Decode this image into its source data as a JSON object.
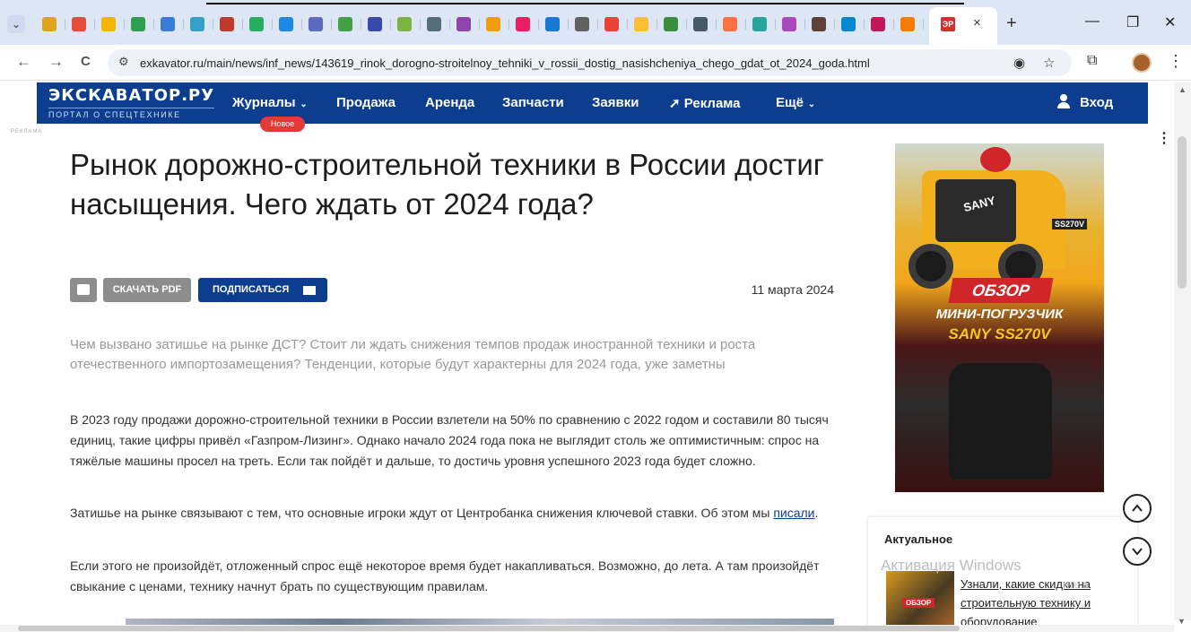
{
  "browser": {
    "tabs_count_icons": 31,
    "active_tab_favicon": "ЭР",
    "url": "exkavator.ru/main/news/inf_news/143619_rinok_dorogno-stroitelnoy_tehniki_v_rossii_dostig_nasishcheniya_chego_gdat_ot_2024_goda.html",
    "icons": {
      "back": "←",
      "forward": "→",
      "reload": "C",
      "close_tab": "×",
      "new_tab": "+",
      "minimize": "—",
      "restore": "❐",
      "close_window": "✕",
      "site_info": "⚙",
      "eye_off": "◉",
      "star": "☆",
      "extensions": "⧉",
      "menu": "⋮"
    }
  },
  "site": {
    "logo": "ЭКСКАВАТОР.РУ",
    "logo_subtitle": "ПОРТАЛ О СПЕЦТЕХНИКЕ",
    "nav": [
      {
        "label": "Журналы",
        "dropdown": true
      },
      {
        "label": "Продажа"
      },
      {
        "label": "Аренда"
      },
      {
        "label": "Запчасти"
      },
      {
        "label": "Заявки"
      },
      {
        "label": "Реклама"
      },
      {
        "label": "Ещё",
        "dropdown": true
      }
    ],
    "nav_badge": "Новое",
    "login": "Вход",
    "ad_label": "РЕКЛАМА"
  },
  "article": {
    "title": "Рынок дорожно-строительной техники в России достиг насыщения. Чего ждать от 2024 года?",
    "btn_pdf": "СКАЧАТЬ PDF",
    "btn_subscribe": "ПОДПИСАТЬСЯ",
    "date": "11 марта 2024",
    "lead": "Чем вызвано затишье на рынке ДСТ? Стоит ли ждать снижения темпов продаж иностранной техники и роста отечественного импортозамещения? Тенденции, которые будут характерны для 2024 года, уже заметны",
    "p1": "В 2023 году продажи дорожно-строительной техники в России взлетели на 50% по сравнению с 2022 годом и составили 80 тысяч единиц, такие цифры привёл «Газпром-Лизинг». Однако начало 2024 года пока не выглядит столь же оптимистичным: спрос на тяжёлые машины просел на треть. Если так пойдёт и дальше, то достичь уровня успешного 2023 года будет сложно.",
    "p2_text": "Затишье на рынке связывают с тем, что основные игроки ждут от Центробанка снижения ключевой ставки. Об этом мы ",
    "p2_link": "писали",
    "p2_end": ".",
    "p3": "Если этого не произойдёт, отложенный спрос ещё некоторое время будет накапливаться. Возможно, до лета. А там произойдёт свыкание с ценами, технику начнут брать по существующим правилам."
  },
  "ad": {
    "brand": "SANY",
    "model_tag": "SS270V",
    "obzor": "ОБЗОР",
    "line1": "МИНИ-ПОГРУЗЧИК",
    "line2": "SANY SS270V"
  },
  "aside": {
    "title": "Актуальное",
    "thumb_tag": "ОБЗОР",
    "link": "Узнали, какие скидки на строительную технику и оборудование"
  },
  "windows": {
    "activation": "Активация Windows",
    "activation_sub": "ите в"
  },
  "colors": {
    "header_bg": "#0c3d8e",
    "badge_red": "#e53935",
    "tabbar_bg": "#dde6f5"
  }
}
